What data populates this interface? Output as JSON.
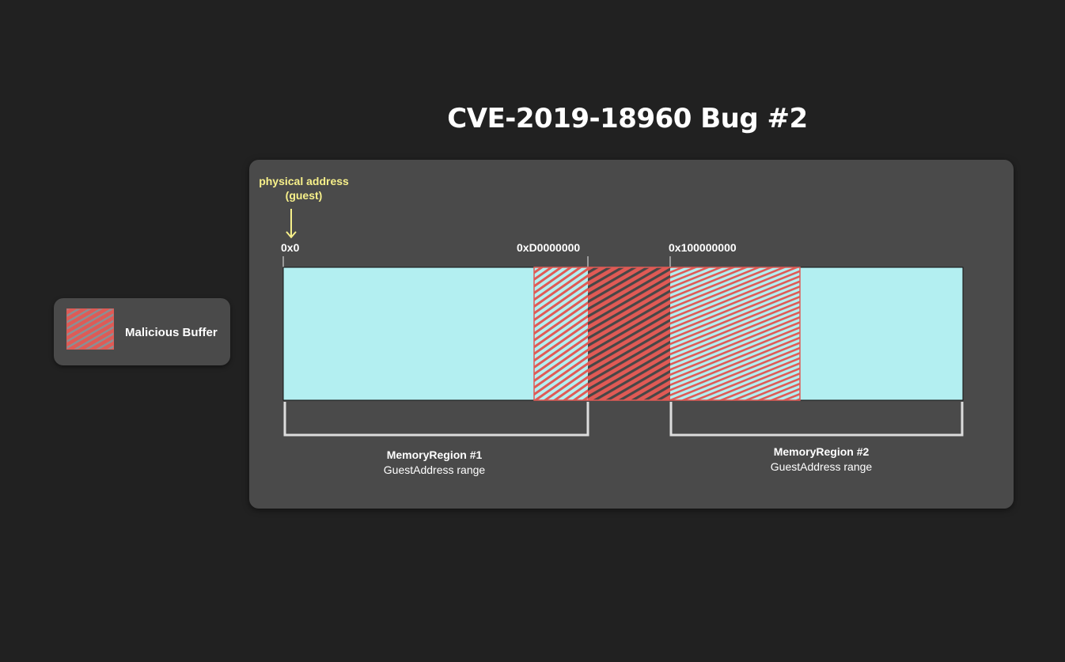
{
  "title": "CVE-2019-18960 Bug #2",
  "legend": {
    "label": "Malicious Buffer",
    "swatch_icon": "hatched-red-swatch"
  },
  "axis": {
    "label_line1": "physical address",
    "label_line2": "(guest)",
    "addresses": [
      "0x0",
      "0xD0000000",
      "0x100000000"
    ]
  },
  "regions": [
    {
      "title": "MemoryRegion #1",
      "subtitle": "GuestAddress range"
    },
    {
      "title": "MemoryRegion #2",
      "subtitle": "GuestAddress range"
    }
  ],
  "colors": {
    "background": "#212121",
    "panel": "#4a4a4a",
    "memory": "#b3eff1",
    "malicious": "#e05a55",
    "accent_yellow": "#f7f08a",
    "bracket": "#dddddd"
  }
}
